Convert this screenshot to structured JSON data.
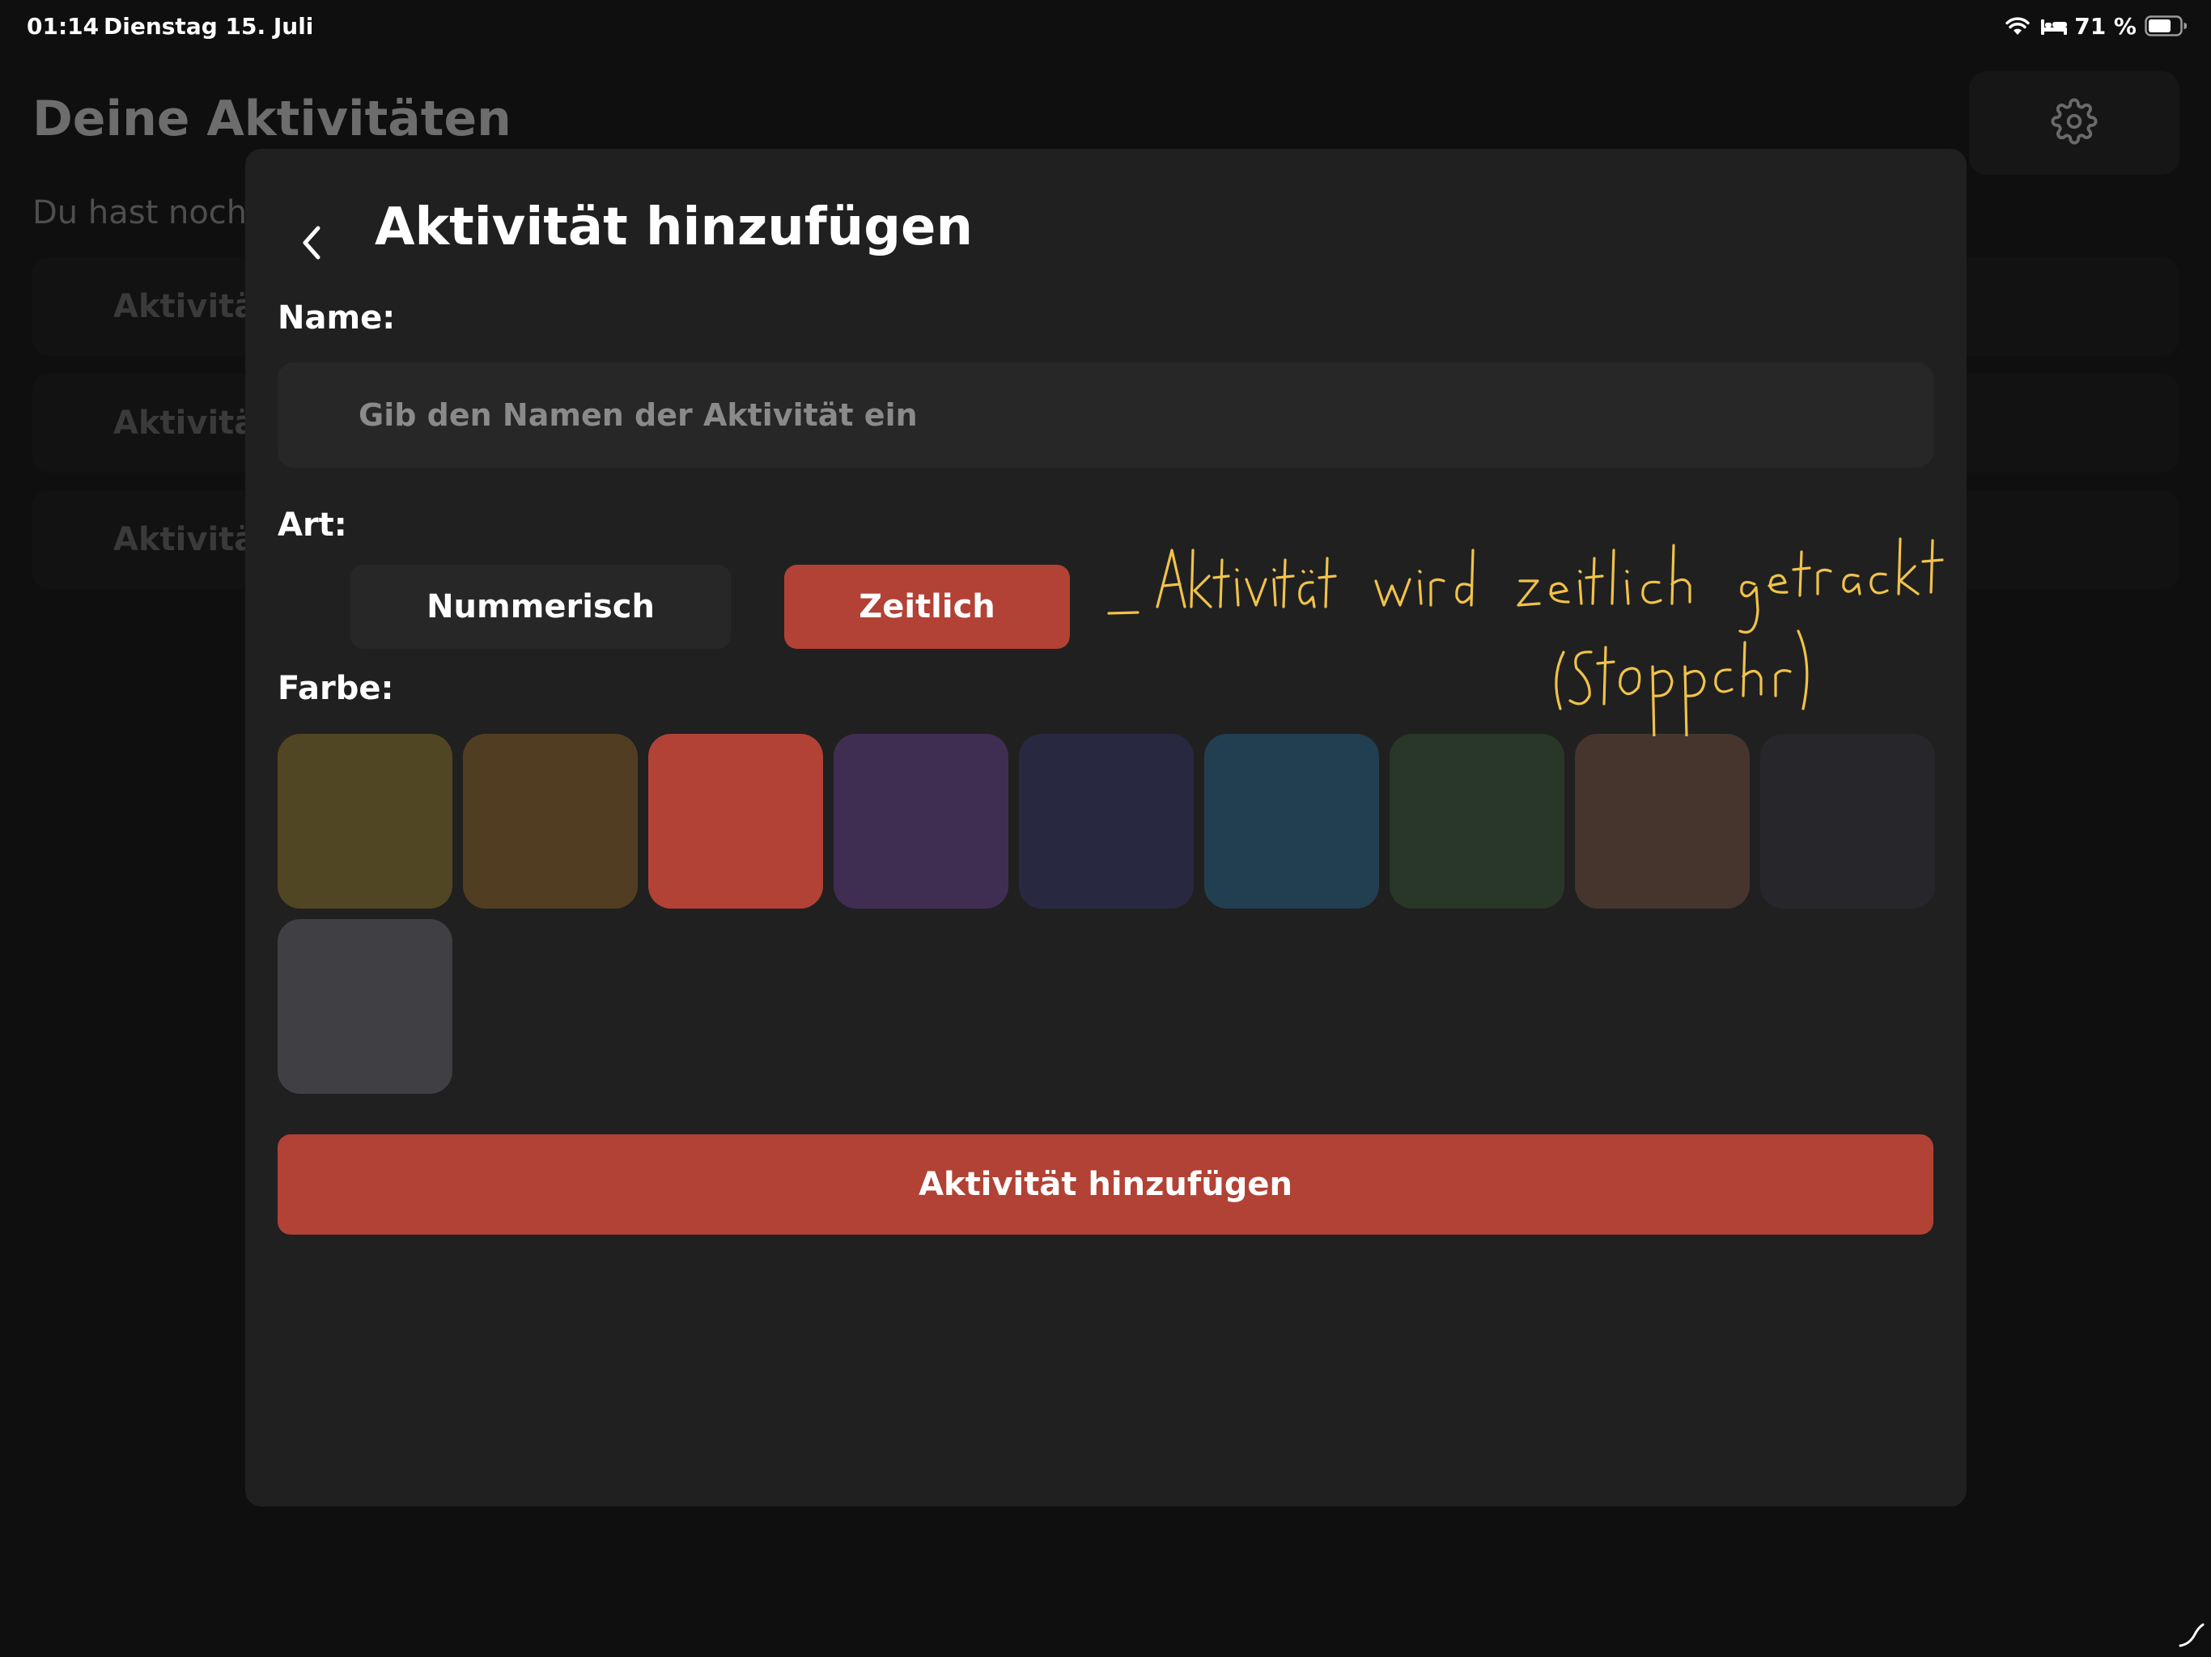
{
  "status_bar": {
    "time": "01:14",
    "date": "Dienstag 15. Juli",
    "battery": "71 %"
  },
  "background": {
    "title": "Deine Aktivitäten",
    "subtitle": "Du hast noch",
    "items": [
      {
        "label": "Aktivitä"
      },
      {
        "label": "Aktivitä"
      },
      {
        "label": "Aktivitä"
      }
    ]
  },
  "modal": {
    "title": "Aktivität hinzufügen",
    "name_label": "Name:",
    "name_placeholder": "Gib den Namen der Aktivität ein",
    "name_value": "",
    "type_label": "Art:",
    "type_options": [
      {
        "label": "Nummerisch",
        "selected": false
      },
      {
        "label": "Zeitlich",
        "selected": true
      }
    ],
    "color_label": "Farbe:",
    "colors": [
      "#514623",
      "#513e22",
      "#b14235",
      "#402e52",
      "#282940",
      "#223e51",
      "#283727",
      "#45352d",
      "#27272b",
      "#404044"
    ],
    "selected_color": "#b14235",
    "submit_label": "Aktivität hinzufügen"
  },
  "annotation": {
    "line1": "Aktivität wird zeitlich getrackt",
    "line2": "(Stoppchr)",
    "color": "#f0c24a"
  },
  "accent_color": "#b14235"
}
